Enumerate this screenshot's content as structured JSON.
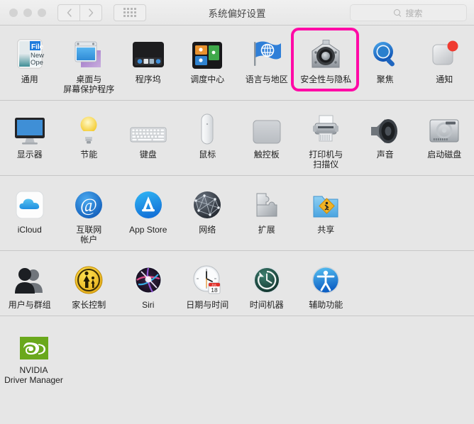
{
  "window": {
    "title": "系统偏好设置",
    "traffic_lights": [
      "close",
      "minimize",
      "zoom"
    ],
    "nav": {
      "back_label": "‹",
      "forward_label": "›"
    },
    "grid_button": "show-all-grid",
    "search": {
      "placeholder": "搜索",
      "value": "",
      "icon": "search-icon"
    }
  },
  "highlight": {
    "target": "安全性与隐私",
    "color": "#ff0aa6"
  },
  "rows": [
    {
      "items": [
        {
          "label": "通用",
          "icon": "general-icon"
        },
        {
          "label": "桌面与\n屏幕保护程序",
          "icon": "desktop-screensaver-icon"
        },
        {
          "label": "程序坞",
          "icon": "dock-icon"
        },
        {
          "label": "调度中心",
          "icon": "mission-control-icon"
        },
        {
          "label": "语言与地区",
          "icon": "language-region-icon"
        },
        {
          "label": "安全性与隐私",
          "icon": "security-privacy-icon",
          "highlighted": true
        },
        {
          "label": "聚焦",
          "icon": "spotlight-icon"
        },
        {
          "label": "通知",
          "icon": "notifications-icon"
        }
      ]
    },
    {
      "items": [
        {
          "label": "显示器",
          "icon": "displays-icon"
        },
        {
          "label": "节能",
          "icon": "energy-saver-icon"
        },
        {
          "label": "键盘",
          "icon": "keyboard-icon"
        },
        {
          "label": "鼠标",
          "icon": "mouse-icon"
        },
        {
          "label": "触控板",
          "icon": "trackpad-icon"
        },
        {
          "label": "打印机与\n扫描仪",
          "icon": "printers-scanners-icon"
        },
        {
          "label": "声音",
          "icon": "sound-icon"
        },
        {
          "label": "启动磁盘",
          "icon": "startup-disk-icon"
        }
      ]
    },
    {
      "items": [
        {
          "label": "iCloud",
          "icon": "icloud-icon"
        },
        {
          "label": "互联网\n帐户",
          "icon": "internet-accounts-icon"
        },
        {
          "label": "App Store",
          "icon": "app-store-icon"
        },
        {
          "label": "网络",
          "icon": "network-icon"
        },
        {
          "label": "扩展",
          "icon": "extensions-icon"
        },
        {
          "label": "共享",
          "icon": "sharing-icon"
        }
      ]
    },
    {
      "items": [
        {
          "label": "用户与群组",
          "icon": "users-groups-icon"
        },
        {
          "label": "家长控制",
          "icon": "parental-controls-icon"
        },
        {
          "label": "Siri",
          "icon": "siri-icon"
        },
        {
          "label": "日期与时间",
          "icon": "date-time-icon"
        },
        {
          "label": "时间机器",
          "icon": "time-machine-icon"
        },
        {
          "label": "辅助功能",
          "icon": "accessibility-icon"
        }
      ]
    },
    {
      "items": [
        {
          "label": "NVIDIA\nDriver Manager",
          "icon": "nvidia-driver-manager-icon"
        }
      ]
    }
  ]
}
